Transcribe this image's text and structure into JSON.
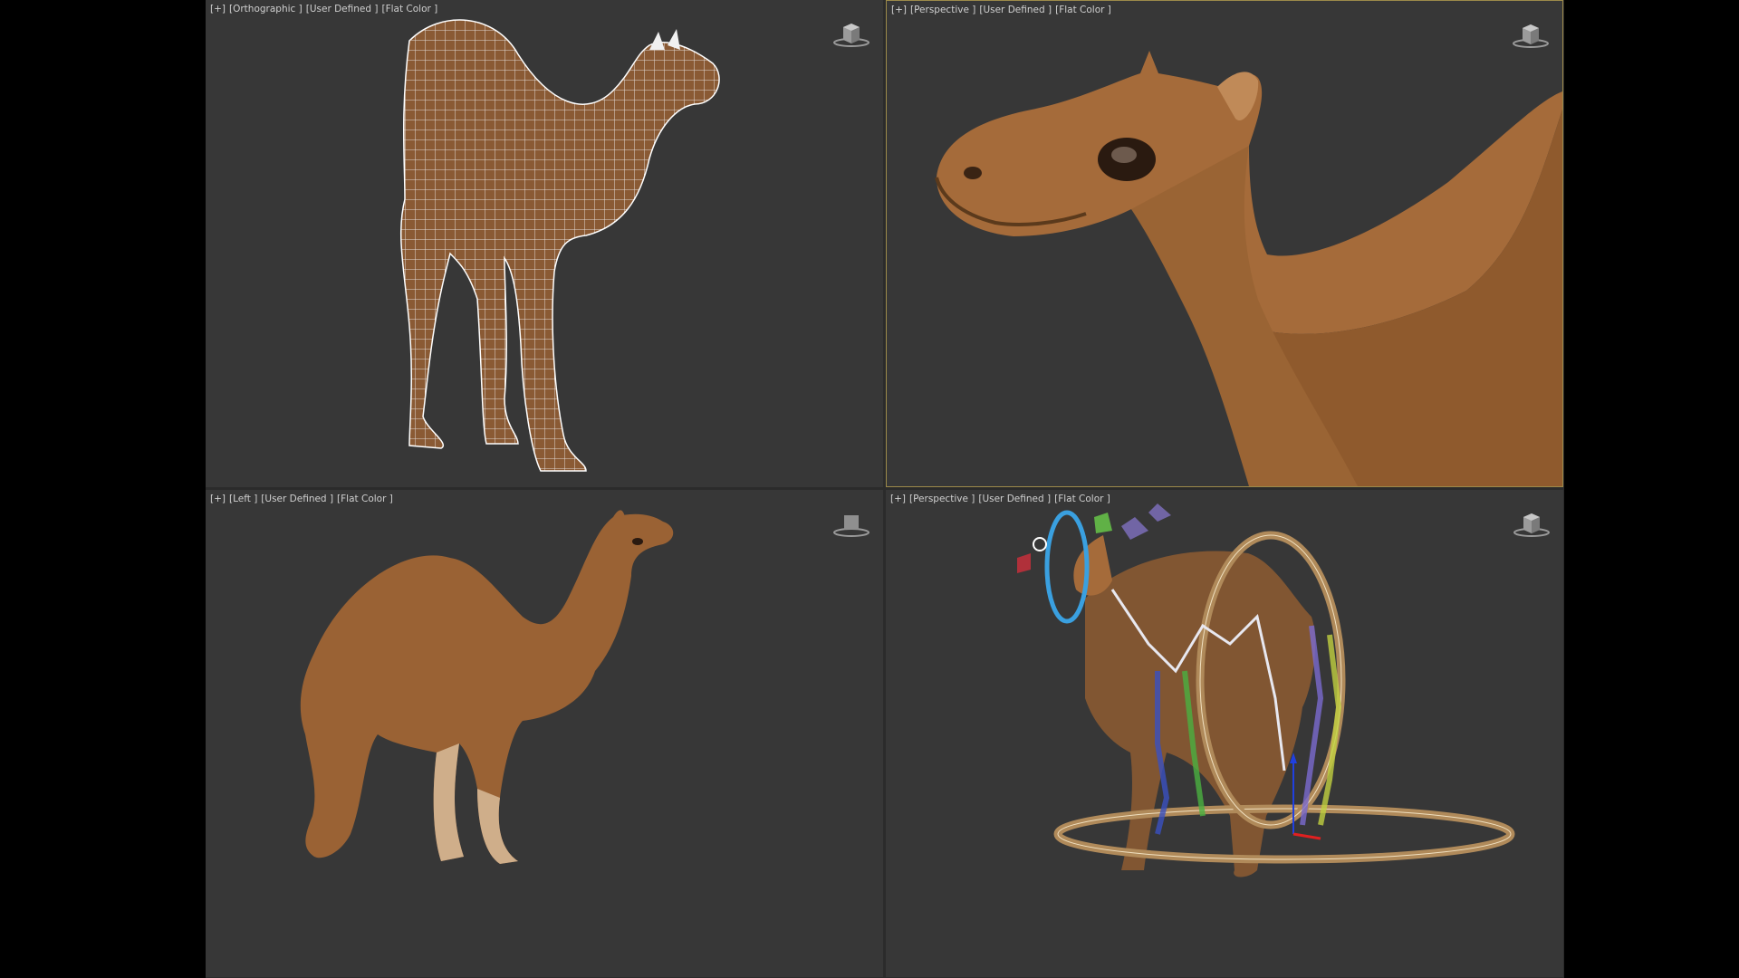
{
  "viewports": [
    {
      "id": "top-left",
      "labels": [
        "[+]",
        "[Orthographic ]",
        "[User Defined ]",
        "[Flat Color ]"
      ],
      "icon": "viewcube-icon",
      "content": "camel-wireframe"
    },
    {
      "id": "top-right",
      "labels": [
        "[+]",
        "[Perspective ]",
        "[User Defined ]",
        "[Flat Color ]"
      ],
      "icon": "viewcube-icon",
      "content": "camel-head-closeup",
      "active": true
    },
    {
      "id": "bottom-left",
      "labels": [
        "[+]",
        "[Left ]",
        "[User Defined ]",
        "[Flat Color ]"
      ],
      "icon": "viewcube-icon",
      "content": "camel-side-view"
    },
    {
      "id": "bottom-right",
      "labels": [
        "[+]",
        "[Perspective ]",
        "[User Defined ]",
        "[Flat Color ]"
      ],
      "icon": "viewcube-icon",
      "content": "camel-rig-bones"
    }
  ],
  "colors": {
    "viewport_bg": "#373737",
    "active_border": "#9c8a4a",
    "camel_fur": "#a0683a",
    "wire": "#f0f0f0",
    "rig_ring": "#b08a5a",
    "rig_blue": "#3aa0e0"
  }
}
